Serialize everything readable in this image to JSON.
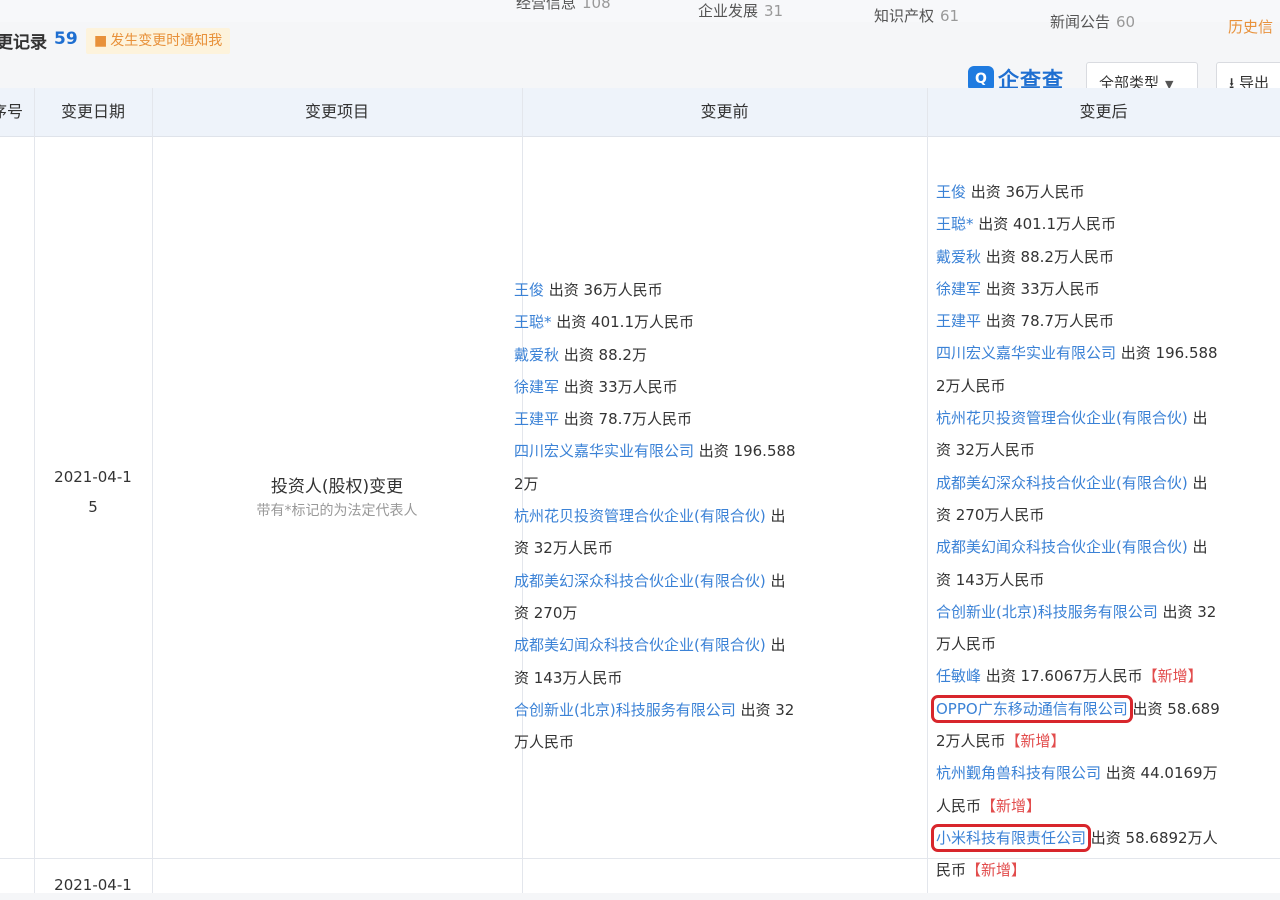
{
  "nav": {
    "tabs": [
      {
        "label": "经营信息",
        "count": "108"
      },
      {
        "label": "企业发展",
        "count": "31"
      },
      {
        "label": "知识产权",
        "count": "61"
      },
      {
        "label": "新闻公告",
        "count": "60"
      }
    ],
    "history": "历史信"
  },
  "section": {
    "title": "更记录",
    "count": "59",
    "notify_label": "发生变更时通知我"
  },
  "toolbar": {
    "brand": "企查查",
    "type_filter": "全部类型",
    "export_label": "导出"
  },
  "table": {
    "headers": {
      "index": "序号",
      "date": "变更日期",
      "item": "变更项目",
      "before": "变更前",
      "after": "变更后"
    },
    "rows": [
      {
        "date_line1": "2021-04-1",
        "date_line2": "5",
        "item_title": "投资人(股权)变更",
        "item_note": "带有*标记的为法定代表人",
        "before_lines": [
          [
            {
              "t": "name",
              "v": "王俊"
            },
            {
              "t": "desc",
              "v": " 出资 36万人民币"
            }
          ],
          [
            {
              "t": "name",
              "v": "王聪*"
            },
            {
              "t": "desc",
              "v": " 出资 401.1万人民币"
            }
          ],
          [
            {
              "t": "name",
              "v": "戴爱秋"
            },
            {
              "t": "desc",
              "v": " 出资 88.2万"
            }
          ],
          [
            {
              "t": "name",
              "v": "徐建军"
            },
            {
              "t": "desc",
              "v": " 出资 33万人民币"
            }
          ],
          [
            {
              "t": "name",
              "v": "王建平"
            },
            {
              "t": "desc",
              "v": " 出资 78.7万人民币"
            }
          ],
          [
            {
              "t": "name",
              "v": "四川宏义嘉华实业有限公司"
            },
            {
              "t": "desc",
              "v": " 出资 196.588"
            }
          ],
          [
            {
              "t": "desc",
              "v": "2万"
            }
          ],
          [
            {
              "t": "name",
              "v": "杭州花贝投资管理合伙企业(有限合伙)"
            },
            {
              "t": "desc",
              "v": " 出"
            }
          ],
          [
            {
              "t": "desc",
              "v": "资 32万人民币"
            }
          ],
          [
            {
              "t": "name",
              "v": "成都美幻深众科技合伙企业(有限合伙)"
            },
            {
              "t": "desc",
              "v": " 出"
            }
          ],
          [
            {
              "t": "desc",
              "v": "资 270万"
            }
          ],
          [
            {
              "t": "name",
              "v": "成都美幻闻众科技合伙企业(有限合伙)"
            },
            {
              "t": "desc",
              "v": " 出"
            }
          ],
          [
            {
              "t": "desc",
              "v": "资 143万人民币"
            }
          ],
          [
            {
              "t": "name",
              "v": "合创新业(北京)科技服务有限公司"
            },
            {
              "t": "desc",
              "v": " 出资 32"
            }
          ],
          [
            {
              "t": "desc",
              "v": "万人民币"
            }
          ]
        ],
        "after_lines": [
          [
            {
              "t": "name",
              "v": "王俊"
            },
            {
              "t": "desc",
              "v": " 出资 36万人民币"
            }
          ],
          [
            {
              "t": "name",
              "v": "王聪*"
            },
            {
              "t": "desc",
              "v": " 出资 401.1万人民币"
            }
          ],
          [
            {
              "t": "name",
              "v": "戴爱秋"
            },
            {
              "t": "desc",
              "v": " 出资 88.2万人民币"
            }
          ],
          [
            {
              "t": "name",
              "v": "徐建军"
            },
            {
              "t": "desc",
              "v": " 出资 33万人民币"
            }
          ],
          [
            {
              "t": "name",
              "v": "王建平"
            },
            {
              "t": "desc",
              "v": " 出资 78.7万人民币"
            }
          ],
          [
            {
              "t": "name",
              "v": "四川宏义嘉华实业有限公司"
            },
            {
              "t": "desc",
              "v": " 出资 196.588"
            }
          ],
          [
            {
              "t": "desc",
              "v": "2万人民币"
            }
          ],
          [
            {
              "t": "name",
              "v": "杭州花贝投资管理合伙企业(有限合伙)"
            },
            {
              "t": "desc",
              "v": " 出"
            }
          ],
          [
            {
              "t": "desc",
              "v": "资 32万人民币"
            }
          ],
          [
            {
              "t": "name",
              "v": "成都美幻深众科技合伙企业(有限合伙)"
            },
            {
              "t": "desc",
              "v": " 出"
            }
          ],
          [
            {
              "t": "desc",
              "v": "资 270万人民币"
            }
          ],
          [
            {
              "t": "name",
              "v": "成都美幻闻众科技合伙企业(有限合伙)"
            },
            {
              "t": "desc",
              "v": " 出"
            }
          ],
          [
            {
              "t": "desc",
              "v": "资 143万人民币"
            }
          ],
          [
            {
              "t": "name",
              "v": "合创新业(北京)科技服务有限公司"
            },
            {
              "t": "desc",
              "v": " 出资 32"
            }
          ],
          [
            {
              "t": "desc",
              "v": "万人民币"
            }
          ],
          [
            {
              "t": "name",
              "v": "任敏峰"
            },
            {
              "t": "desc",
              "v": " 出资 17.6067万人民币"
            },
            {
              "t": "tag",
              "v": "【新增】"
            }
          ],
          [
            {
              "t": "name",
              "v": "OPPO广东移动通信有限公司",
              "boxed": true
            },
            {
              "t": "desc",
              "v": " 出资 58.689"
            }
          ],
          [
            {
              "t": "desc",
              "v": "2万人民币"
            },
            {
              "t": "tag",
              "v": "【新增】"
            }
          ],
          [
            {
              "t": "name",
              "v": "杭州觐角兽科技有限公司"
            },
            {
              "t": "desc",
              "v": " 出资 44.0169万"
            }
          ],
          [
            {
              "t": "desc",
              "v": "人民币"
            },
            {
              "t": "tag",
              "v": "【新增】"
            }
          ],
          [
            {
              "t": "name",
              "v": "小米科技有限责任公司",
              "boxed": true
            },
            {
              "t": "desc",
              "v": " 出资 58.6892万人"
            }
          ],
          [
            {
              "t": "desc",
              "v": "民币"
            },
            {
              "t": "tag",
              "v": "【新增】"
            }
          ]
        ]
      },
      {
        "date_line1": "2021-04-1"
      }
    ]
  },
  "colors": {
    "link": "#3b82d6",
    "tag_new": "#e24c4c",
    "highlight_box": "#d8262c",
    "brand": "#1f6fd1",
    "notify_bg": "#fdf3dc",
    "notify_text": "#e8913a",
    "header_bg": "#eef3fa"
  },
  "icons": {
    "notify": "bell-icon",
    "brand": "qcc-logo-icon",
    "caret": "caret-down-icon",
    "export": "download-icon"
  }
}
